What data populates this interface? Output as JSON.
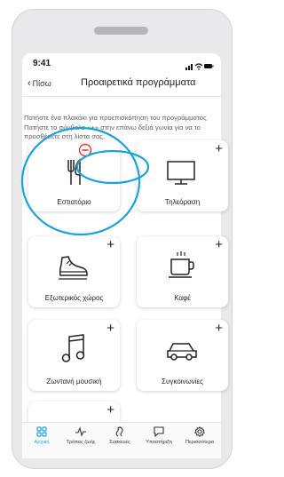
{
  "status": {
    "time": "9:41"
  },
  "nav": {
    "back_label": "Πίσω",
    "title": "Προαιρετικά προγράμματα"
  },
  "description": "Πατήστε ένα πλακάκι για προεπισκόπηση του προγράμματος. Πατήστε το σύμβολο «+» στην επάνω δεξιά γωνία για να το προσθέσετε στη λίστα σας.",
  "tiles": [
    {
      "label": "Εστιατόριο",
      "icon": "cutlery-icon",
      "action": "remove"
    },
    {
      "label": "Τηλεόραση",
      "icon": "tv-icon",
      "action": "add"
    },
    {
      "label": "Εξωτερικός χώρος",
      "icon": "shoe-icon",
      "action": "add"
    },
    {
      "label": "Καφέ",
      "icon": "coffee-cup-icon",
      "action": "add"
    },
    {
      "label": "Ζωντανή μουσική",
      "icon": "music-note-icon",
      "action": "add"
    },
    {
      "label": "Συγκοινωνίες",
      "icon": "car-icon",
      "action": "add"
    }
  ],
  "plus_symbol": "+",
  "tabs": [
    {
      "label": "Αρχική",
      "icon": "grid-icon",
      "active": true
    },
    {
      "label": "Τρόπος ζωής",
      "icon": "activity-icon",
      "active": false
    },
    {
      "label": "Συσκευές",
      "icon": "hearing-aid-icon",
      "active": false
    },
    {
      "label": "Υποστήριξη",
      "icon": "chat-icon",
      "active": false
    },
    {
      "label": "Περισσότερα",
      "icon": "gear-icon",
      "active": false
    }
  ],
  "colors": {
    "accent": "#1aa7d6",
    "remove": "#e53935",
    "highlight": "#1ba3d8"
  }
}
